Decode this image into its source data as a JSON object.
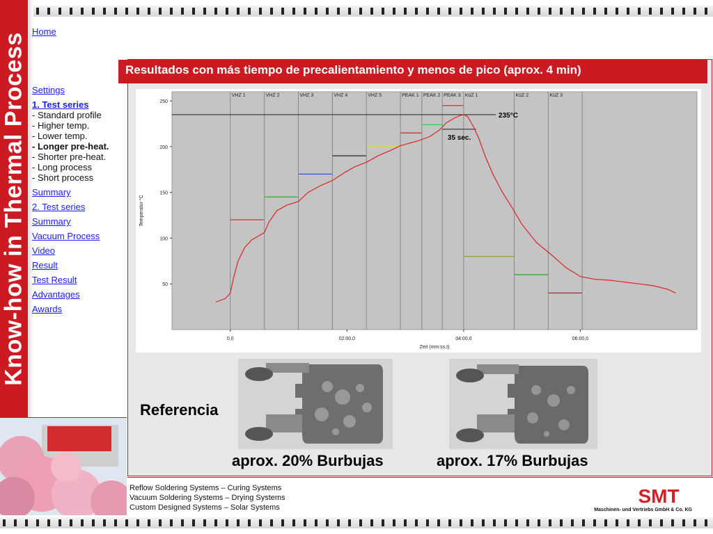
{
  "sidebar": {
    "title": "Know-how in Thermal Process",
    "home": "Home",
    "links": {
      "settings": "Settings",
      "test_series_1": "1. Test series",
      "summary_1": "Summary",
      "test_series_2": "2. Test series",
      "summary_2": "Summary",
      "vacuum": "Vacuum Process",
      "video": "Video",
      "result": "Result",
      "test_result": "Test Result",
      "advantages": "Advantages",
      "awards": "Awards"
    },
    "sub_items": {
      "standard": "- Standard profile",
      "higher": "- Higher temp.",
      "lower": "- Lower temp.",
      "longer": "- Longer pre-heat.",
      "shorter": "- Shorter pre-heat.",
      "long": "- Long process",
      "short": "- Short process"
    }
  },
  "content": {
    "title": "Resultados con más tiempo de precalientamiento y menos de pico (aprox. 4 min)",
    "reference_label": "Referencia",
    "caption_left": "aprox. 20% Burbujas",
    "caption_right": "aprox. 17% Burbujas"
  },
  "footer": {
    "line1": "Reflow Soldering Systems – Curing Systems",
    "line2": "Vacuum Soldering Systems – Drying Systems",
    "line3": "Custom Designed Systems – Solar Systems",
    "company": "Maschinen- und Vertriebs GmbH & Co. KG",
    "logo": "SMT"
  },
  "colors": {
    "accent": "#cc1a22",
    "link": "#1a1aff"
  },
  "chart_data": {
    "type": "line",
    "xlabel": "Zeit (mm:ss,t)",
    "ylabel": "Temperatur °C",
    "x_unit": "seconds",
    "xlim": [
      -60,
      480
    ],
    "ylim": [
      0,
      260
    ],
    "x_ticks": [
      "0,0",
      "02:00,0",
      "04:00,0",
      "06:00,0"
    ],
    "x_tick_values": [
      0,
      120,
      240,
      360
    ],
    "y_ticks": [
      50,
      100,
      150,
      200,
      250
    ],
    "zones": [
      {
        "name": "VHZ 1",
        "start": 0,
        "end": 35,
        "set": 120,
        "color": "#cc3333"
      },
      {
        "name": "VHZ 2",
        "start": 35,
        "end": 70,
        "set": 145,
        "color": "#33aa33"
      },
      {
        "name": "VHZ 3",
        "start": 70,
        "end": 105,
        "set": 170,
        "color": "#3355dd"
      },
      {
        "name": "VHZ 4",
        "start": 105,
        "end": 140,
        "set": 190,
        "color": "#333333"
      },
      {
        "name": "VHZ 5",
        "start": 140,
        "end": 175,
        "set": 200,
        "color": "#dddd33"
      },
      {
        "name": "PEAK 1",
        "start": 175,
        "end": 197,
        "set": 215,
        "color": "#cc3333"
      },
      {
        "name": "PEAK 2",
        "start": 197,
        "end": 218,
        "set": 224,
        "color": "#33cc33"
      },
      {
        "name": "PEAK 3",
        "start": 218,
        "end": 240,
        "set": 245,
        "color": "#cc3333"
      },
      {
        "name": "KüZ 1",
        "start": 240,
        "end": 292,
        "set": 80,
        "color": "#999933"
      },
      {
        "name": "KüZ 2",
        "start": 292,
        "end": 327,
        "set": 60,
        "color": "#33aa33"
      },
      {
        "name": "KüZ 3",
        "start": 327,
        "end": 362,
        "set": 40,
        "color": "#993333"
      }
    ],
    "series": [
      {
        "color": "#dd2222",
        "x": [
          -15,
          -5,
          0,
          3,
          8,
          15,
          22,
          30,
          35,
          40,
          48,
          58,
          70,
          80,
          92,
          105,
          118,
          128,
          140,
          152,
          165,
          175,
          185,
          195,
          205,
          215,
          222,
          230,
          236,
          240,
          244,
          250,
          256,
          262,
          270,
          280,
          290,
          300,
          315,
          330,
          345,
          360,
          375,
          390,
          405,
          420,
          435,
          450,
          458
        ],
        "values": [
          30,
          34,
          40,
          55,
          75,
          90,
          98,
          103,
          106,
          118,
          130,
          136,
          140,
          150,
          157,
          163,
          172,
          178,
          183,
          190,
          196,
          201,
          204,
          207,
          211,
          218,
          226,
          231,
          234,
          235,
          233,
          222,
          208,
          190,
          170,
          150,
          133,
          115,
          95,
          82,
          68,
          58,
          55,
          54,
          52,
          50,
          48,
          44,
          40
        ]
      }
    ],
    "reference_line": {
      "value": 235,
      "label": "235°C"
    },
    "annotation": "35 sec.",
    "peak_band": [
      218,
      253
    ]
  }
}
